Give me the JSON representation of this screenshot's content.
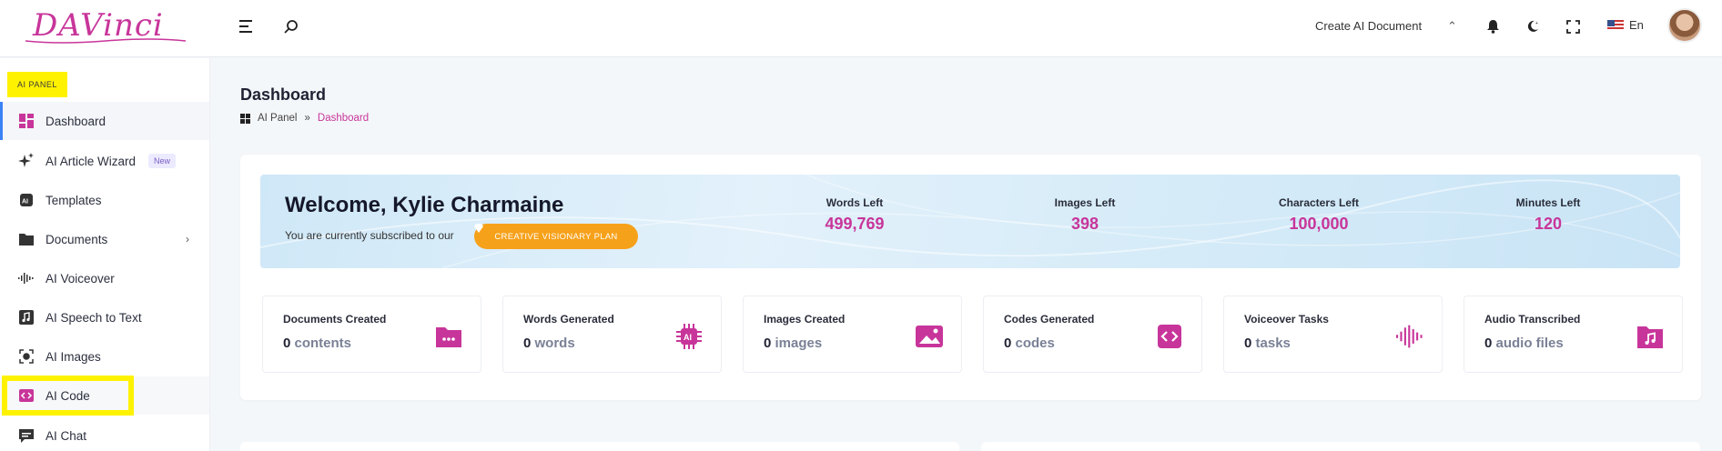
{
  "brand": {
    "logo_text": "DAVinci",
    "accent_color": "#c8359a",
    "highlight_color": "#fff200"
  },
  "header": {
    "create_document_label": "Create AI Document",
    "language_label": "En",
    "icons": [
      "menu-icon",
      "search-icon",
      "chevron-up-icon",
      "bell-icon",
      "moon-icon",
      "fullscreen-icon"
    ]
  },
  "sidebar": {
    "section_label": "AI PANEL",
    "items": [
      {
        "label": "Dashboard",
        "icon": "dashboard-icon",
        "active": true
      },
      {
        "label": "AI Article Wizard",
        "icon": "sparkle-icon",
        "badge": "New"
      },
      {
        "label": "Templates",
        "icon": "ai-chip-icon"
      },
      {
        "label": "Documents",
        "icon": "folder-icon",
        "has_submenu": true
      },
      {
        "label": "AI Voiceover",
        "icon": "waveform-icon"
      },
      {
        "label": "AI Speech to Text",
        "icon": "music-note-icon"
      },
      {
        "label": "AI Images",
        "icon": "image-icon"
      },
      {
        "label": "AI Code",
        "icon": "code-icon",
        "highlighted": true
      },
      {
        "label": "AI Chat",
        "icon": "chat-icon"
      }
    ]
  },
  "main": {
    "page_title": "Dashboard",
    "breadcrumb": [
      "AI Panel",
      "»",
      "Dashboard"
    ],
    "welcome": {
      "title": "Welcome, Kylie Charmaine",
      "subscribed_text": "You are currently subscribed to our",
      "plan_label": "CREATIVE VISIONARY PLAN",
      "stats": [
        {
          "label": "Words Left",
          "value": "499,769"
        },
        {
          "label": "Images Left",
          "value": "398"
        },
        {
          "label": "Characters Left",
          "value": "100,000"
        },
        {
          "label": "Minutes Left",
          "value": "120"
        }
      ]
    },
    "summary": [
      {
        "label": "Documents Created",
        "count": "0",
        "unit": "contents",
        "icon": "folder-icon"
      },
      {
        "label": "Words Generated",
        "count": "0",
        "unit": "words",
        "icon": "ai-chip-icon"
      },
      {
        "label": "Images Created",
        "count": "0",
        "unit": "images",
        "icon": "image-icon"
      },
      {
        "label": "Codes Generated",
        "count": "0",
        "unit": "codes",
        "icon": "code-icon"
      },
      {
        "label": "Voiceover Tasks",
        "count": "0",
        "unit": "tasks",
        "icon": "waveform-icon"
      },
      {
        "label": "Audio Transcribed",
        "count": "0",
        "unit": "audio files",
        "icon": "music-note-icon"
      }
    ]
  }
}
